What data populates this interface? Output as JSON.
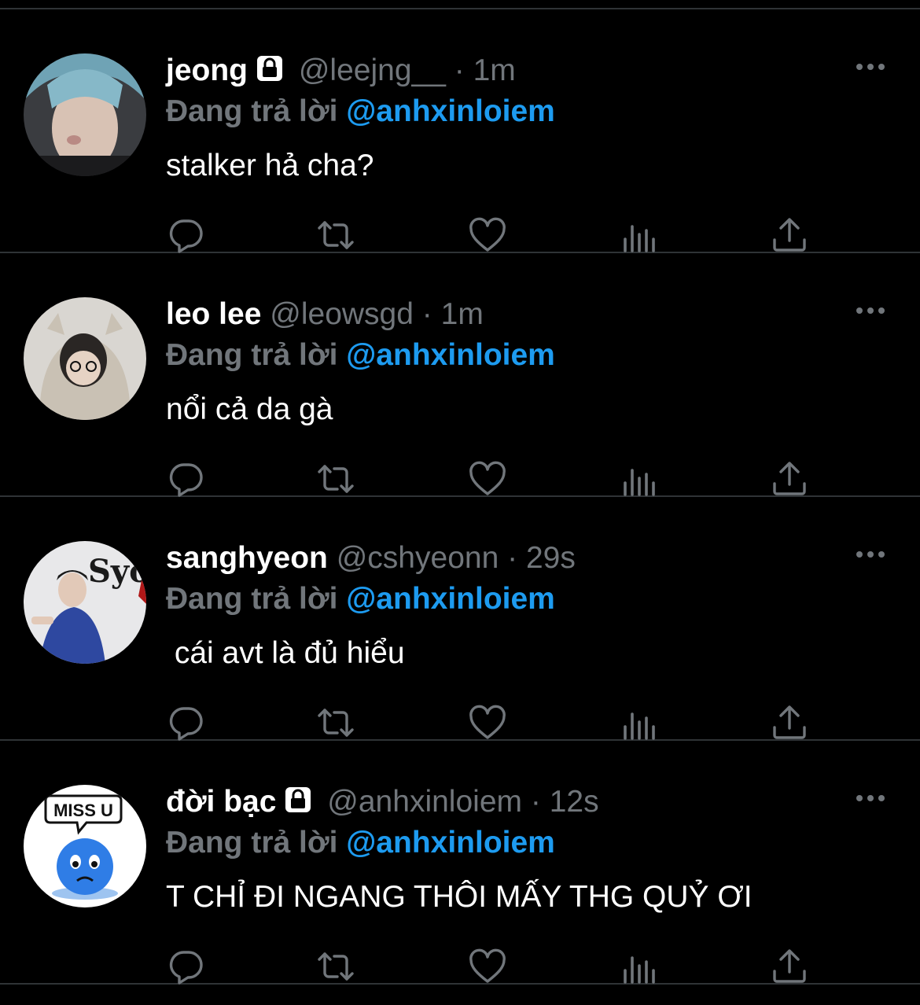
{
  "reply_prefix": "Đang trả lời",
  "separator": "·",
  "colors": {
    "background": "#000000",
    "text": "#ffffff",
    "muted": "#71767b",
    "accent": "#1d9bf0",
    "divider": "#2f3336"
  },
  "icons": {
    "reply": "reply-icon",
    "retweet": "retweet-icon",
    "like": "heart-icon",
    "views": "views-icon",
    "share": "share-icon",
    "more": "more-icon",
    "lock": "lock-icon"
  },
  "tweets": [
    {
      "name": "jeong",
      "locked": true,
      "handle": "@leejng__",
      "time": "1m",
      "reply_to": "@anhxinloiem",
      "text": "stalker hả cha?"
    },
    {
      "name": "leo lee",
      "locked": false,
      "handle": "@leowsgd",
      "time": "1m",
      "reply_to": "@anhxinloiem",
      "text": "nổi cả da gà"
    },
    {
      "name": "sanghyeon",
      "locked": false,
      "handle": "@cshyeonn",
      "time": "29s",
      "reply_to": "@anhxinloiem",
      "text": " cái avt là đủ hiểu",
      "avatar_text": "Syoau"
    },
    {
      "name": "đời bạc",
      "locked": true,
      "handle": "@anhxinloiem",
      "time": "12s",
      "reply_to": "@anhxinloiem",
      "text": "T CHỈ ĐI NGANG THÔI MẤY THG QUỶ ƠI",
      "avatar_text": "MISS U"
    }
  ]
}
